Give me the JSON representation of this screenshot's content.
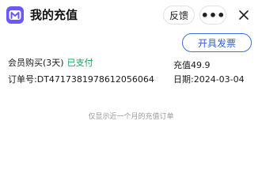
{
  "header": {
    "title": "我的充值",
    "logo_icon": "app-logo-icon",
    "feedback_label": "反馈",
    "more_label": "•••",
    "more_icon": "more-icon",
    "close_icon": "close-icon"
  },
  "invoice_button_label": "开具发票",
  "order": {
    "product": "会员购买(3天)",
    "status": "已支付",
    "order_no_label": "订单号:",
    "order_no": "DT4717381978612056064",
    "amount_label": "充值",
    "amount": "49.9",
    "date_label": "日期:",
    "date": "2024-03-04"
  },
  "footer_note": "仅显示近一个月的充值订单",
  "colors": {
    "accent": "#2f63de",
    "paid": "#18a058",
    "logo": "#6a5af3",
    "muted": "#9a9a9a"
  }
}
